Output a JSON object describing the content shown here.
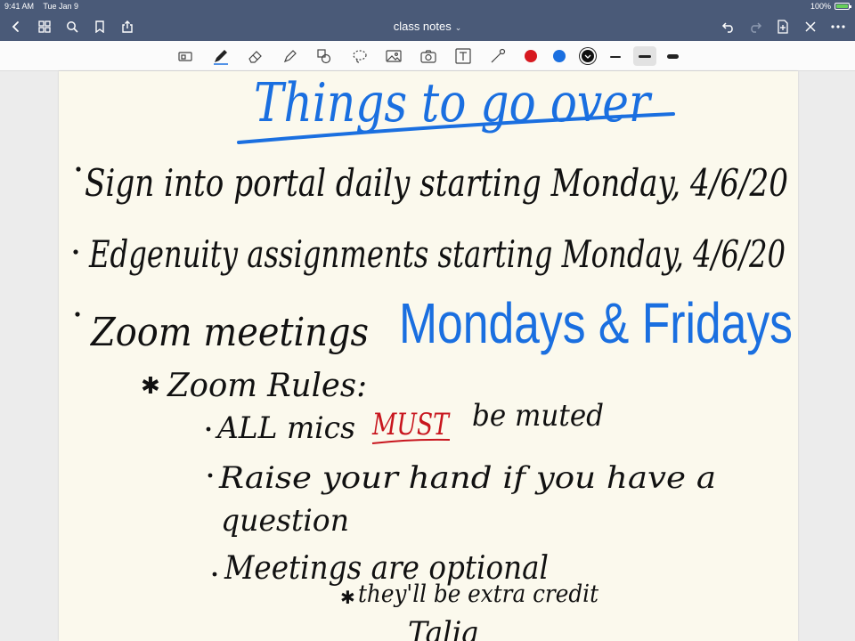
{
  "status_bar": {
    "time": "9:41 AM",
    "date": "Tue Jan 9",
    "battery": "100%"
  },
  "navbar": {
    "title": "class notes"
  },
  "toolbar": {
    "colors": {
      "red": "#d71920",
      "blue": "#1a6fe0",
      "black": "#111111"
    }
  },
  "note": {
    "heading": "Things to go over",
    "line1": "Sign into portal daily starting Monday, 4/6/20",
    "line2": "Edgenuity assignments starting Monday, 4/6/20",
    "line3_prefix": "Zoom meetings",
    "line3_highlight": "Mondays & Fridays",
    "rules_heading": "Zoom Rules:",
    "rule1_a": "ALL mics",
    "rule1_emphasis": "MUST",
    "rule1_b": "be muted",
    "rule2_a": "Raise your hand if you have a",
    "rule2_b": "question",
    "rule3": "Meetings are optional",
    "rule3_note": "they'll be extra credit",
    "signature": "Talia"
  },
  "ink_colors": {
    "blue": "#1a6fe0",
    "black": "#111111",
    "red": "#c8161e"
  }
}
